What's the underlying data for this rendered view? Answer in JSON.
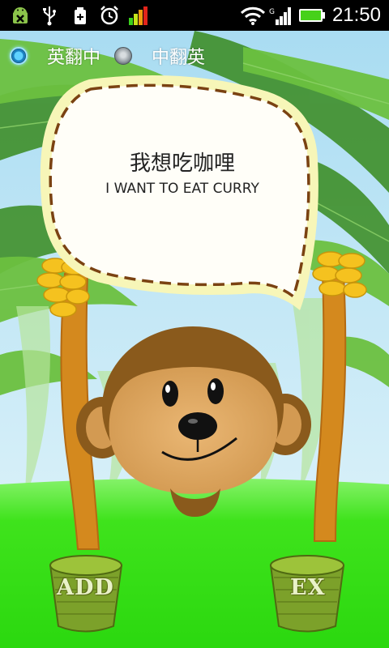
{
  "status_bar": {
    "time": "21:50",
    "icons": [
      "android-debug-icon",
      "usb-icon",
      "battery-saver-icon",
      "alarm-icon",
      "signal-bars-icon",
      "wifi-icon",
      "cell-signal-icon",
      "battery-icon"
    ]
  },
  "translation_mode": {
    "options": [
      {
        "label": "英翻中",
        "selected": true
      },
      {
        "label": "中翻英",
        "selected": false
      }
    ]
  },
  "bubble": {
    "chinese": "我想吃咖哩",
    "english": "I WANT TO EAT CURRY"
  },
  "baskets": {
    "add_label": "ADD",
    "ex_label": "EX"
  },
  "colors": {
    "sky": "#bfe6f5",
    "grass": "#39e01c",
    "monkey_fur": "#8a5a1c",
    "monkey_face": "#e0ad69",
    "banana": "#f5c21f",
    "bubble_fill": "#fffbe0"
  }
}
